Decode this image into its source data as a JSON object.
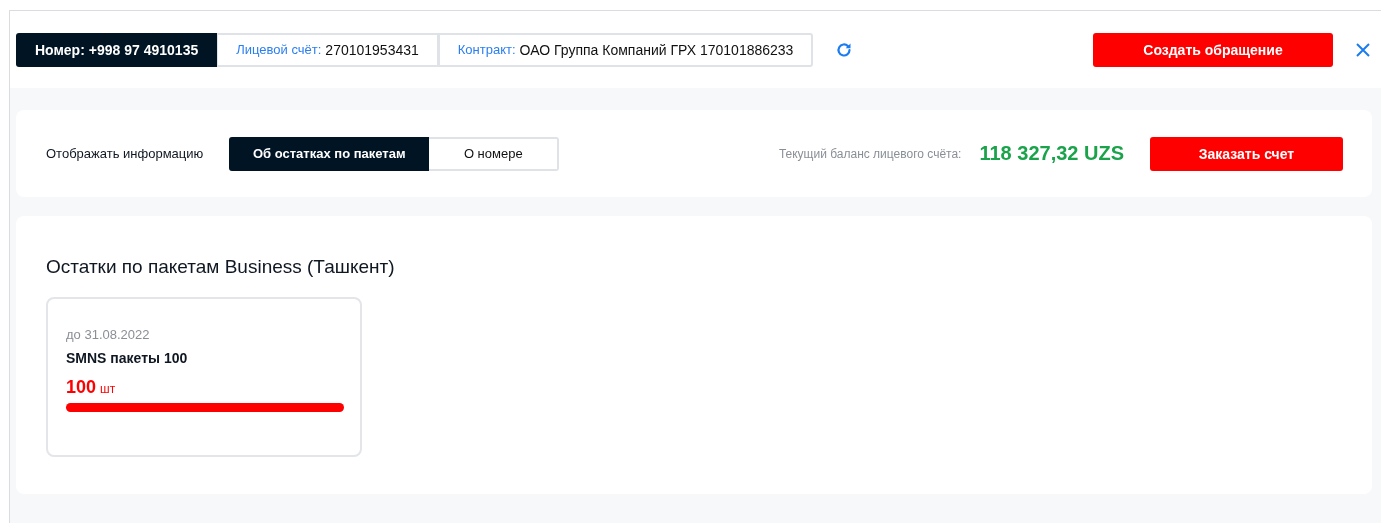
{
  "header": {
    "chips": [
      {
        "kind": "dark",
        "label": "Номер:",
        "value": "+998 97 4910135"
      },
      {
        "kind": "light",
        "label": "Лицевой счёт:",
        "value": "270101953431"
      },
      {
        "kind": "light",
        "label": "Контракт:",
        "value": "ОАО Группа Компаний ГРХ 170101886233"
      }
    ],
    "action_button": "Создать обращение"
  },
  "display": {
    "label": "Отображать информацию",
    "options": [
      {
        "label": "Об остатках по пакетам",
        "selected": true
      },
      {
        "label": "О номере",
        "selected": false
      }
    ],
    "balance_label": "Текущий баланс лицевого счёта:",
    "balance_value": "118 327,32 UZS",
    "button": "Заказать счет"
  },
  "packages": {
    "title": "Остатки по пакетам Business (Ташкент)",
    "cards": [
      {
        "valid_until": "до 31.08.2022",
        "name": "SMNS пакеты 100",
        "amount": "100",
        "unit": "шт",
        "level": 1
      }
    ]
  }
}
